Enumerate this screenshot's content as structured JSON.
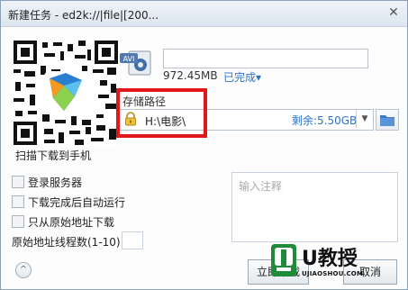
{
  "window": {
    "title": "新建任务 - ed2k://|file|[200...",
    "close_symbol": "✕"
  },
  "qr": {
    "label": "扫描下载到手机"
  },
  "file": {
    "type_badge": "AVI",
    "name_value": "",
    "size": "972.45MB",
    "status": "已完成▾"
  },
  "save_path": {
    "label": "存储路径",
    "value": "H:\\电影\\",
    "remaining": "剩余:5.50GB",
    "dropdown_symbol": "▼"
  },
  "options": [
    {
      "label": "登录服务器",
      "checked": false
    },
    {
      "label": "下载完成后自动运行",
      "checked": false
    },
    {
      "label": "只从原始地址下载",
      "checked": false
    }
  ],
  "threads": {
    "label": "原始地址线程数(1-10)",
    "value": ""
  },
  "notes": {
    "placeholder": "输入注释"
  },
  "buttons": {
    "help": "^",
    "download": "立即下载",
    "cancel": "取消"
  },
  "watermark": {
    "brand": "U教授",
    "domain": "UJIAOSHOU.COM"
  },
  "colors": {
    "highlight": "#e3171a",
    "link_blue": "#2c74c8"
  }
}
